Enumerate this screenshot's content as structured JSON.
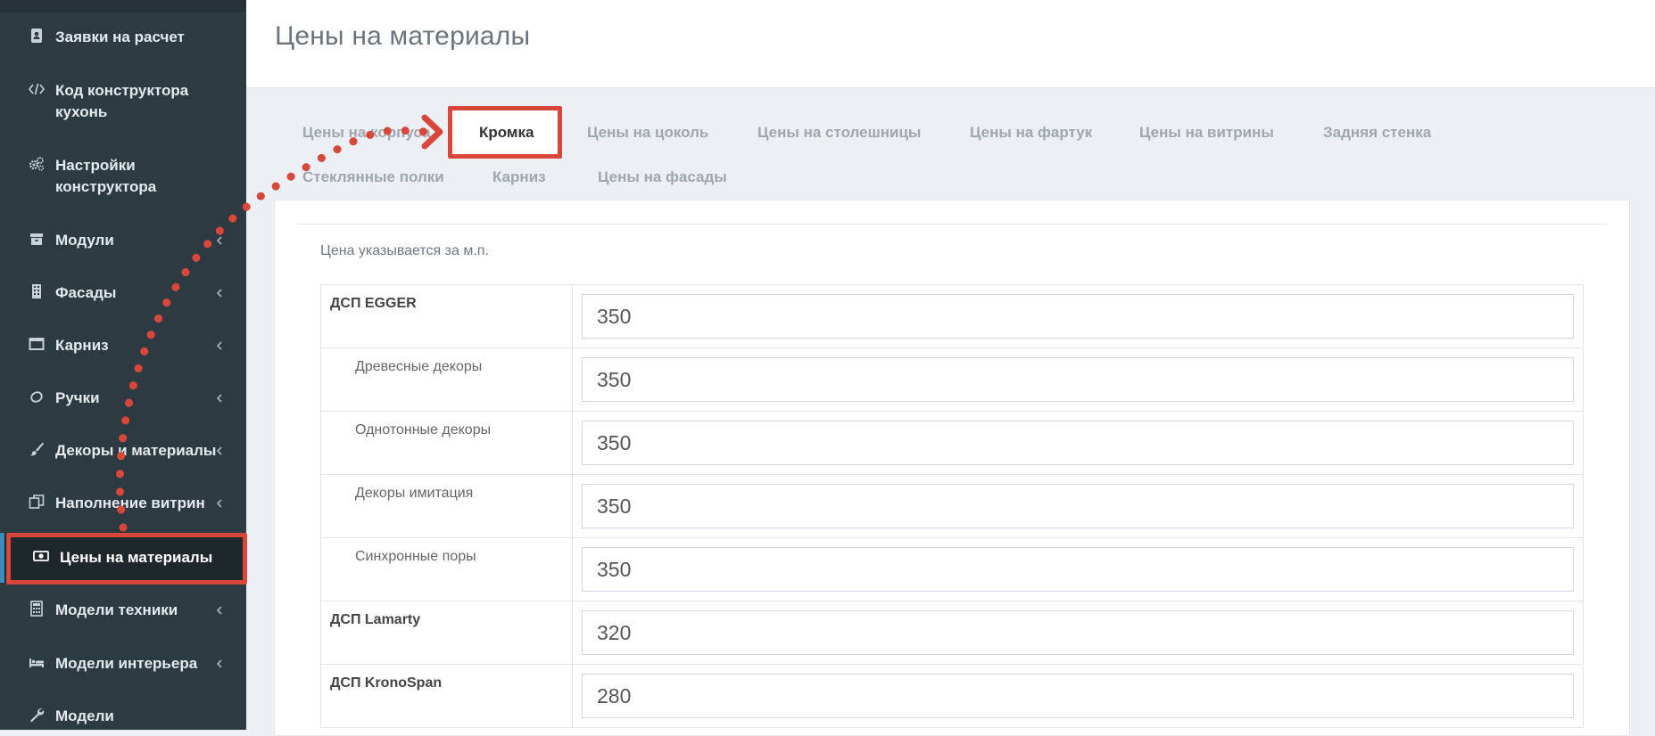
{
  "page": {
    "title": "Цены на материалы"
  },
  "sidebar": {
    "items": [
      {
        "label": "Заявки на расчет",
        "icon": "contact-book-icon",
        "has_children": false
      },
      {
        "label": "Код конструктора кухонь",
        "icon": "code-icon",
        "has_children": false
      },
      {
        "label": "Настройки конструктора",
        "icon": "gears-icon",
        "has_children": false
      },
      {
        "label": "Модули",
        "icon": "archive-icon",
        "has_children": true
      },
      {
        "label": "Фасады",
        "icon": "building-icon",
        "has_children": true
      },
      {
        "label": "Карниз",
        "icon": "window-icon",
        "has_children": true
      },
      {
        "label": "Ручки",
        "icon": "lemon-icon",
        "has_children": true
      },
      {
        "label": "Декоры и материалы",
        "icon": "paint-brush-icon",
        "has_children": true
      },
      {
        "label": "Наполнение витрин",
        "icon": "clone-icon",
        "has_children": true
      },
      {
        "label": "Цены на материалы",
        "icon": "money-icon",
        "has_children": false,
        "active": true
      },
      {
        "label": "Модели техники",
        "icon": "calculator-icon",
        "has_children": true
      },
      {
        "label": "Модели интерьера",
        "icon": "bed-icon",
        "has_children": true
      },
      {
        "label": "Модели",
        "icon": "wrench-icon",
        "has_children": false
      }
    ]
  },
  "tabs": [
    {
      "label": "Цены на корпуса"
    },
    {
      "label": "Кромка",
      "active": true
    },
    {
      "label": "Цены на цоколь"
    },
    {
      "label": "Цены на столешницы"
    },
    {
      "label": "Цены на фартук"
    },
    {
      "label": "Цены на витрины"
    },
    {
      "label": "Задняя стенка"
    },
    {
      "label": "Стеклянные полки"
    },
    {
      "label": "Карниз"
    },
    {
      "label": "Цены на фасады"
    }
  ],
  "content": {
    "note": "Цена указывается за м.п.",
    "rows": [
      {
        "name": "ДСП EGGER",
        "value": "350",
        "level": "group"
      },
      {
        "name": "Древесные декоры",
        "value": "350",
        "level": "sub"
      },
      {
        "name": "Однотонные декоры",
        "value": "350",
        "level": "sub"
      },
      {
        "name": "Декоры имитация",
        "value": "350",
        "level": "sub"
      },
      {
        "name": "Синхронные поры",
        "value": "350",
        "level": "sub"
      },
      {
        "name": "ДСП Lamarty",
        "value": "320",
        "level": "group"
      },
      {
        "name": "ДСП KronoSpan",
        "value": "280",
        "level": "group"
      }
    ]
  },
  "colors": {
    "sidebar_bg": "#2c3b41",
    "active_bg": "#1e282c",
    "highlight": "#d9473b",
    "accent": "#3c8dbc"
  }
}
